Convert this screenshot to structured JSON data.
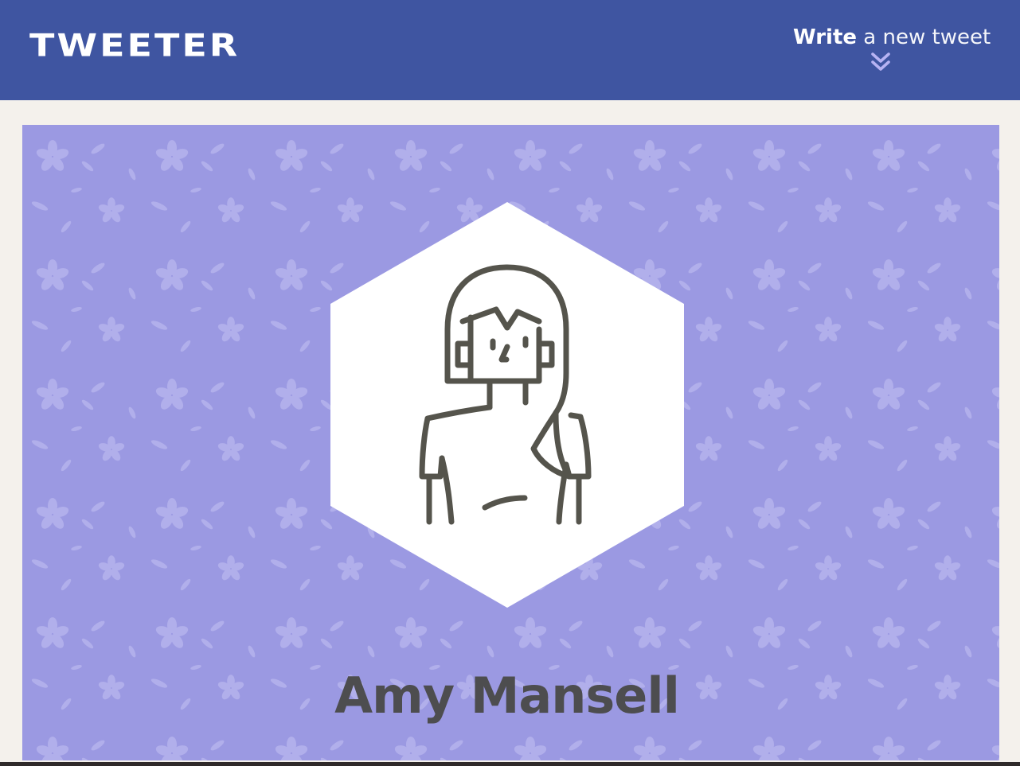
{
  "header": {
    "logo_text": "TWEETER",
    "compose": {
      "strong": "Write",
      "rest": " a new tweet",
      "icon": "double-chevron-down-icon"
    }
  },
  "profile": {
    "display_name": "Amy Mansell",
    "avatar_icon": "woman-avatar-icon",
    "background_pattern": "floral-pattern"
  },
  "colors": {
    "nav_background": "#3f55a1",
    "page_background": "#f4f1ec",
    "profile_background": "#9b99e2",
    "chevron": "#b7b3f3",
    "avatar_stroke": "#55544c",
    "name_text": "#4d4d4f"
  }
}
